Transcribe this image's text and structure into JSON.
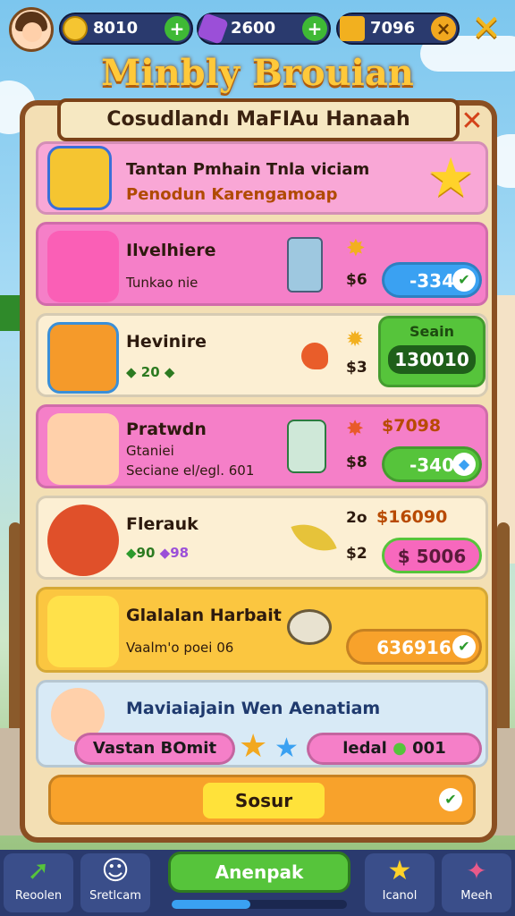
{
  "hud": {
    "coins": "8010",
    "gems": "2600",
    "gold": "7096"
  },
  "game_title": "Minbly Brouian",
  "panel": {
    "title": "Cosudlandı MaFIAu Hanaah"
  },
  "banner": {
    "line1": "Tantan Pmhain Tnla viciam",
    "line2": "Penodun Karengamoap"
  },
  "items": [
    {
      "title": "Ilvelhiere",
      "subtitle": "Tunkao nie",
      "price_small": "$6",
      "button": "-334"
    },
    {
      "title": "Hevinire",
      "subtitle": "20",
      "price_small": "$3",
      "button_label": "Seain",
      "button": "130010"
    },
    {
      "title": "Pratwdn",
      "subtitle": "Gtaniei",
      "subtitle2": "Seciane el/egl. 601",
      "price_small": "$8",
      "price_big": "$7098",
      "button": "-340"
    },
    {
      "title": "Flerauk",
      "subtitle": "90",
      "subtitle_b": "98",
      "price_small": "$2",
      "price_big": "$16090",
      "prefix": "2o",
      "button": "$ 5006"
    },
    {
      "title": "Glalalan Harbait",
      "subtitle": "Vaalm'o poei 06",
      "button": "636916"
    }
  ],
  "promo": {
    "title": "Maviaiajain Wen Aenatiam",
    "left_pill": "Vastan BOmit",
    "right_pill": "ledal",
    "right_value": "001"
  },
  "confirm_button": "Sosur",
  "bottom_nav": {
    "item1": "Reoolen",
    "item2": "Sretlcam",
    "center": "Anenpak",
    "item4": "Icanol",
    "item5": "Meeh"
  },
  "colors": {
    "pink": "#f57fc8",
    "green": "#56c43b",
    "blue": "#3aa1f2",
    "orange": "#f8a22b",
    "panel": "#f3dfb4"
  }
}
